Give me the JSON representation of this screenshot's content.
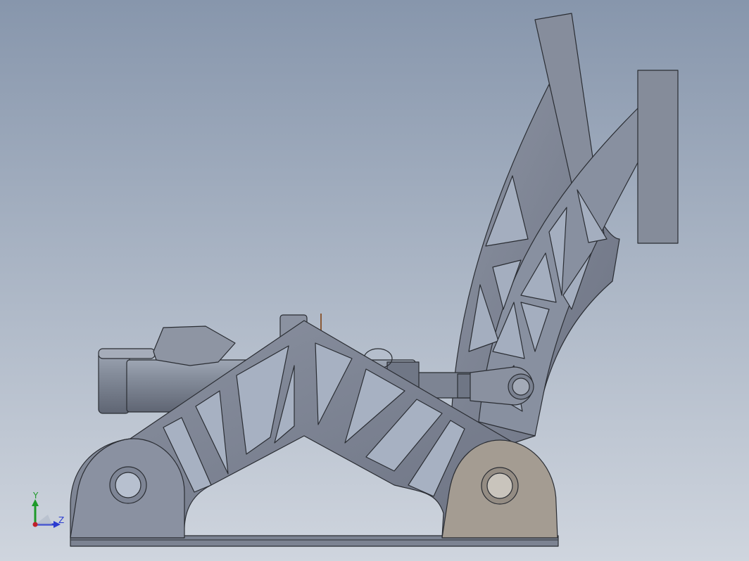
{
  "viewport": {
    "name": "3d-model-viewport",
    "background_colors": [
      "#8796ac",
      "#cfd5de"
    ]
  },
  "model": {
    "part_color": "#7e8696",
    "part_light": "#9aa2b2",
    "part_dark": "#5b6170",
    "outline": "#2a2d33",
    "highlight_mount_color": "#a49c92",
    "accent_color": "#8a5a36"
  },
  "triad": {
    "y_label": "Y",
    "z_label": "Z",
    "y_color": "#1e9a2a",
    "z_color": "#2a3bd0",
    "origin_color": "#c0202a"
  }
}
